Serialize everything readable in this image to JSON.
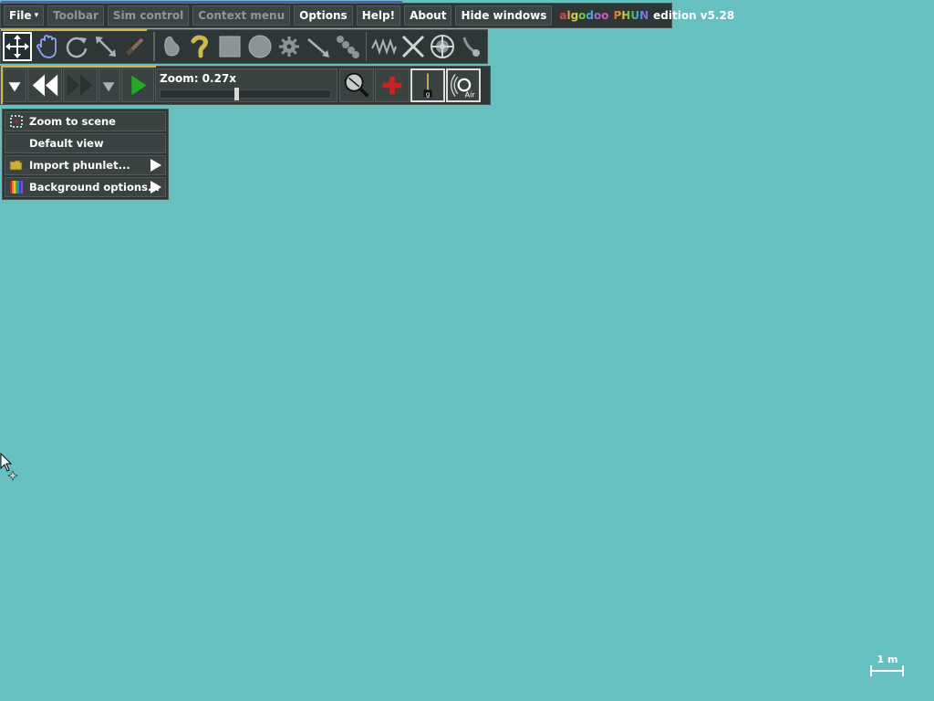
{
  "menubar": {
    "items": [
      {
        "label": "File",
        "dim": false,
        "caret": "▾"
      },
      {
        "label": "Toolbar",
        "dim": true
      },
      {
        "label": "Sim control",
        "dim": true
      },
      {
        "label": "Context menu",
        "dim": true
      },
      {
        "label": "Options",
        "dim": false
      },
      {
        "label": "Help!",
        "dim": false
      },
      {
        "label": "About",
        "dim": false
      },
      {
        "label": "Hide windows",
        "dim": false
      }
    ],
    "brand": {
      "algodoo": "algodoo",
      "phun": "PHUN",
      "edition": "edition v5.28"
    }
  },
  "toolbar": {
    "tools": [
      "move-tool-icon",
      "drag-hand-icon",
      "rotate-icon",
      "scale-icon",
      "knife-icon",
      "sketch-icon",
      "brush-icon",
      "box-icon",
      "circle-icon",
      "gear-icon",
      "chain-icon",
      "plane-icon",
      "spring-icon",
      "fixate-icon",
      "hinge-icon",
      "tracer-icon"
    ],
    "active_tool": "move-tool-icon"
  },
  "simcontrol": {
    "zoom_label": "Zoom: 0.27x",
    "zoom_level": 0.45,
    "gravity_label": "g",
    "air_label": "Air"
  },
  "context_menu": {
    "items": [
      {
        "label": "Zoom to scene",
        "icon": "zoom-to-scene-icon",
        "submenu": false
      },
      {
        "label": "Default view",
        "icon": "",
        "submenu": false
      },
      {
        "label": "Import phunlet...",
        "icon": "folder-icon",
        "submenu": true
      },
      {
        "label": "Background options...",
        "icon": "rainbow-icon",
        "submenu": true
      }
    ]
  },
  "scale": {
    "label": "1 m"
  },
  "colors": {
    "background": "#67c0c0",
    "panel": "#2f3636",
    "accent": "#d1b84d",
    "play": "#22aa22"
  }
}
